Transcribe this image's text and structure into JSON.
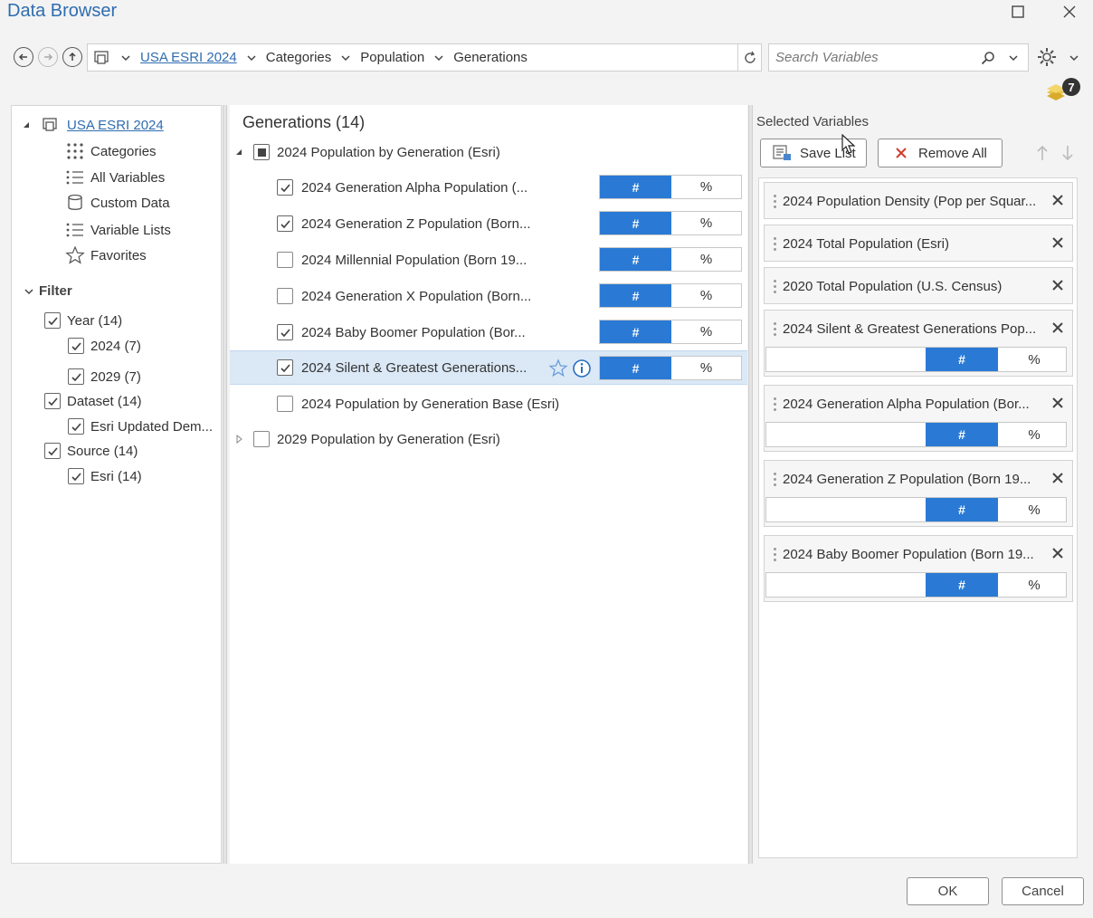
{
  "window": {
    "title": "Data Browser"
  },
  "nav": {
    "breadcrumbs": [
      "USA ESRI 2024",
      "Categories",
      "Population",
      "Generations"
    ],
    "search_placeholder": "Search Variables",
    "badge_count": "7"
  },
  "tree": {
    "root_label": "USA ESRI 2024",
    "items": [
      "Categories",
      "All Variables",
      "Custom Data",
      "Variable Lists",
      "Favorites"
    ],
    "filter_label": "Filter",
    "filters": [
      {
        "label": "Year (14)",
        "checked": true
      },
      {
        "label": "2024 (7)",
        "checked": true
      },
      {
        "label": "2029 (7)",
        "checked": true
      },
      {
        "label": "Dataset (14)",
        "checked": true
      },
      {
        "label": "Esri Updated Dem...",
        "checked": true
      },
      {
        "label": "Source (14)",
        "checked": true
      },
      {
        "label": "Esri (14)",
        "checked": true
      }
    ]
  },
  "middle": {
    "heading": "Generations (14)",
    "group_label": "2024 Population by Generation (Esri)",
    "rows": [
      {
        "label": "2024 Generation Alpha Population (...",
        "checked": true
      },
      {
        "label": "2024 Generation Z Population (Born...",
        "checked": true
      },
      {
        "label": "2024 Millennial Population (Born 19...",
        "checked": false
      },
      {
        "label": "2024 Generation X Population (Born...",
        "checked": false
      },
      {
        "label": "2024 Baby Boomer Population (Bor...",
        "checked": true
      },
      {
        "label": "2024 Silent & Greatest Generations...",
        "checked": true
      }
    ],
    "base_row_label": "2024 Population by Generation Base (Esri)",
    "group2_label": "2029 Population by Generation (Esri)",
    "hash_label": "#",
    "pct_label": "%"
  },
  "selected": {
    "heading": "Selected Variables",
    "save_list_label": "Save List",
    "remove_all_label": "Remove All",
    "items": [
      "2024 Population Density (Pop per Squar...",
      "2024 Total Population (Esri)",
      "2020 Total Population (U.S. Census)",
      "2024 Silent & Greatest Generations Pop...",
      "2024 Generation Alpha Population (Bor...",
      "2024 Generation Z Population (Born 19...",
      "2024 Baby Boomer Population (Born 19..."
    ]
  },
  "footer": {
    "ok_label": "OK",
    "cancel_label": "Cancel"
  },
  "colors": {
    "accent_blue": "#2a7ad5",
    "title_blue": "#2f6db0",
    "highlight_row": "#dbe8f6"
  }
}
